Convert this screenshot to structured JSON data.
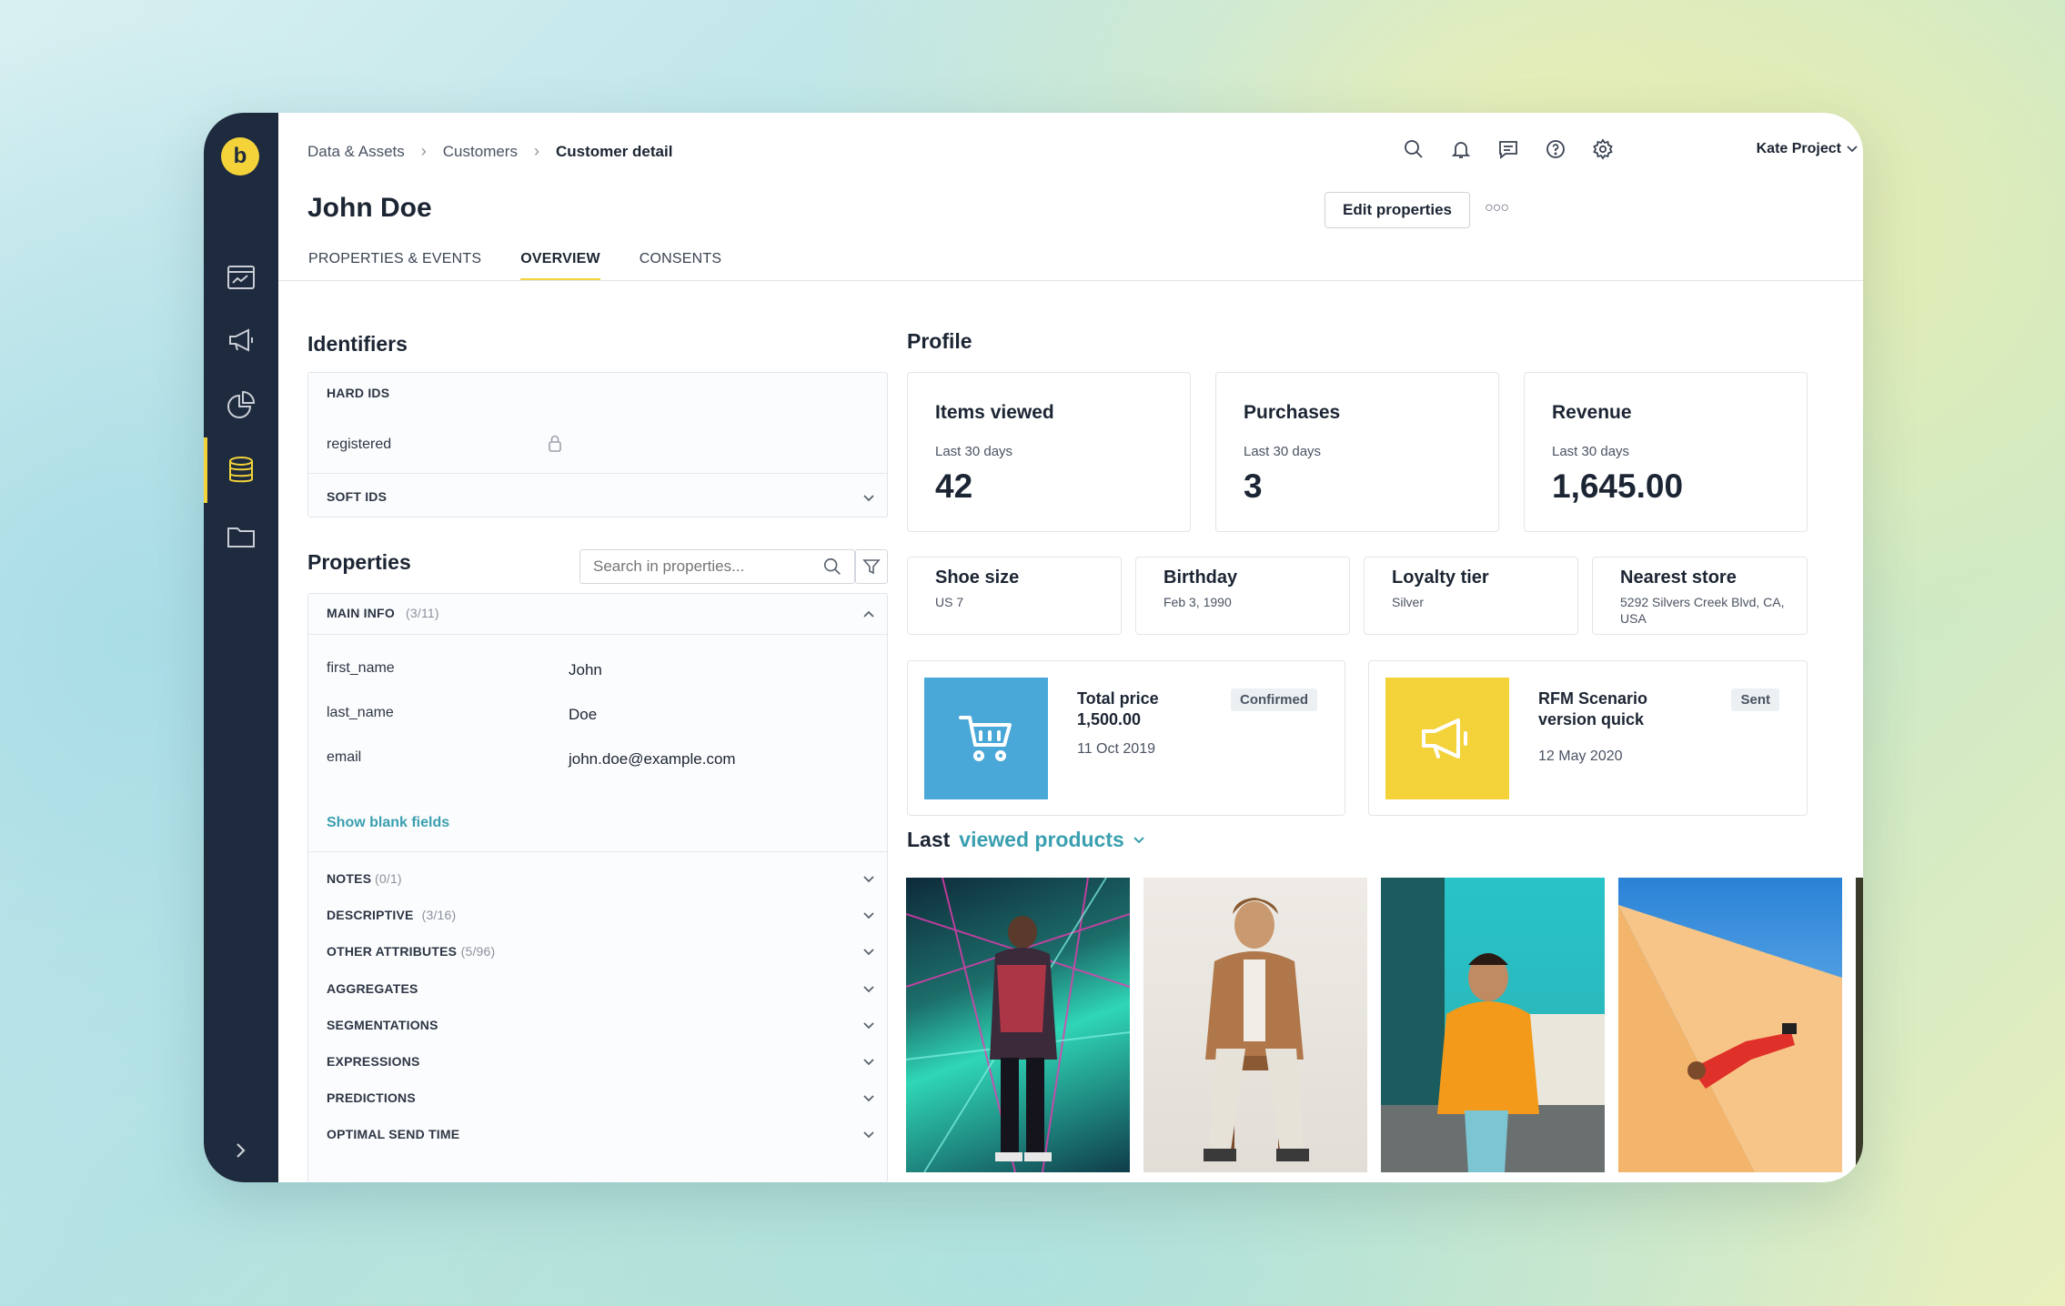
{
  "breadcrumb": {
    "items": [
      "Data & Assets",
      "Customers"
    ],
    "current": "Customer detail"
  },
  "project": "Kate Project",
  "page_title": "John Doe",
  "actions": {
    "edit": "Edit properties"
  },
  "tabs": [
    "PROPERTIES & EVENTS",
    "OVERVIEW",
    "CONSENTS"
  ],
  "identifiers": {
    "title": "Identifiers",
    "hard_ids_label": "HARD IDS",
    "hard_id": "registered",
    "soft_ids_label": "SOFT IDS"
  },
  "properties": {
    "title": "Properties",
    "search_placeholder": "Search in properties...",
    "main_info_label": "MAIN INFO",
    "main_info_count": "(3/11)",
    "fields": [
      {
        "key": "first_name",
        "value": "John"
      },
      {
        "key": "last_name",
        "value": "Doe"
      },
      {
        "key": "email",
        "value": "john.doe@example.com"
      }
    ],
    "show_blank": "Show blank fields",
    "groups": [
      {
        "label": "NOTES",
        "count": "(0/1)"
      },
      {
        "label": "DESCRIPTIVE",
        "count": "(3/16)"
      },
      {
        "label": "OTHER ATTRIBUTES",
        "count": "(5/96)"
      },
      {
        "label": "AGGREGATES",
        "count": ""
      },
      {
        "label": "SEGMENTATIONS",
        "count": ""
      },
      {
        "label": "EXPRESSIONS",
        "count": ""
      },
      {
        "label": "PREDICTIONS",
        "count": ""
      },
      {
        "label": "OPTIMAL SEND TIME",
        "count": ""
      }
    ]
  },
  "profile": {
    "title": "Profile",
    "stats": [
      {
        "title": "Items viewed",
        "sub": "Last 30 days",
        "value": "42"
      },
      {
        "title": "Purchases",
        "sub": "Last 30 days",
        "value": "3"
      },
      {
        "title": "Revenue",
        "sub": "Last 30 days",
        "value": "1,645.00"
      }
    ],
    "attributes": [
      {
        "title": "Shoe size",
        "value": "US 7"
      },
      {
        "title": "Birthday",
        "value": "Feb 3, 1990"
      },
      {
        "title": "Loyalty tier",
        "value": "Silver"
      },
      {
        "title": "Nearest store",
        "value": "5292 Silvers Creek Blvd, CA, USA"
      }
    ],
    "activity": [
      {
        "title_line1": "Total price",
        "title_line2": "1,500.00",
        "date": "11 Oct 2019",
        "badge": "Confirmed",
        "color": "#4aa8d8"
      },
      {
        "title_line1": "RFM Scenario",
        "title_line2": "version quick",
        "date": "12 May 2020",
        "badge": "Sent",
        "color": "#f3d23a"
      }
    ],
    "products_label_a": "Last",
    "products_label_b": "viewed products"
  },
  "colors": {
    "accent": "#f3d23a",
    "sidebar": "#1e2a3d",
    "link": "#3a9fb0"
  }
}
